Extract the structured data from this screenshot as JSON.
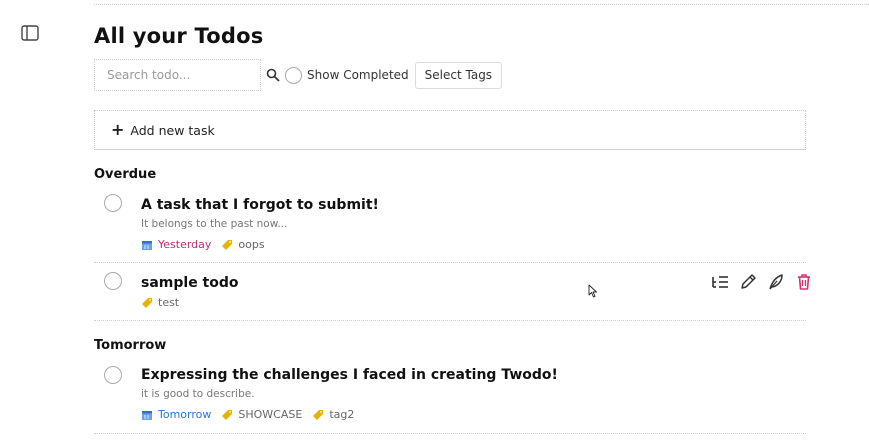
{
  "header": {
    "title": "All your Todos"
  },
  "search": {
    "placeholder": "Search todo...",
    "value": ""
  },
  "filters": {
    "show_completed_label": "Show Completed",
    "select_tags_label": "Select Tags"
  },
  "add_task": {
    "label": "Add new task"
  },
  "sections": [
    {
      "title": "Overdue",
      "tasks": [
        {
          "title": "A task that I forgot to submit!",
          "description": "It belongs to the past now...",
          "due": "Yesterday",
          "tags": [
            "oops"
          ]
        },
        {
          "title": "sample todo",
          "tags": [
            "test"
          ]
        }
      ]
    },
    {
      "title": "Tomorrow",
      "tasks": [
        {
          "title": "Expressing the challenges I faced in creating Twodo!",
          "description": "it is good to describe.",
          "due": "Tomorrow",
          "tags": [
            "SHOWCASE",
            "tag2"
          ]
        }
      ]
    }
  ],
  "icons": {
    "sidebar_toggle": "sidebar-toggle-icon",
    "search": "search-icon",
    "plus": "plus-icon",
    "calendar": "calendar-icon",
    "tag": "tag-icon",
    "subtasks": "subtasks-icon",
    "edit": "pencil-icon",
    "feather": "feather-icon",
    "delete": "trash-icon"
  },
  "colors": {
    "due_overdue": "#b03373",
    "due_upcoming": "#2f72d4",
    "tag_icon": "#e5b400",
    "delete_icon": "#d6336c",
    "action_icon": "#333333"
  }
}
